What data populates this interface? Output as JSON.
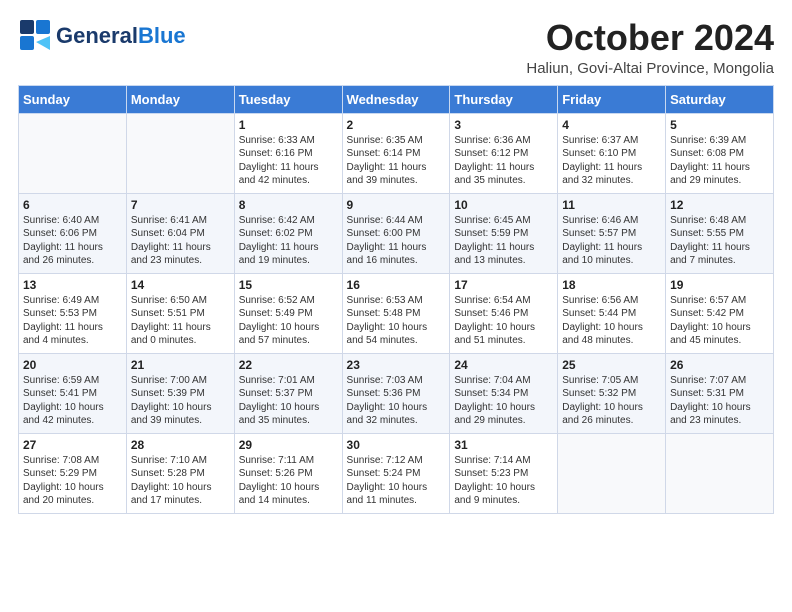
{
  "header": {
    "logo_general": "General",
    "logo_blue": "Blue",
    "month_title": "October 2024",
    "location": "Haliun, Govi-Altai Province, Mongolia"
  },
  "days_of_week": [
    "Sunday",
    "Monday",
    "Tuesday",
    "Wednesday",
    "Thursday",
    "Friday",
    "Saturday"
  ],
  "weeks": [
    [
      {
        "day": "",
        "info": ""
      },
      {
        "day": "",
        "info": ""
      },
      {
        "day": "1",
        "info": "Sunrise: 6:33 AM\nSunset: 6:16 PM\nDaylight: 11 hours and 42 minutes."
      },
      {
        "day": "2",
        "info": "Sunrise: 6:35 AM\nSunset: 6:14 PM\nDaylight: 11 hours and 39 minutes."
      },
      {
        "day": "3",
        "info": "Sunrise: 6:36 AM\nSunset: 6:12 PM\nDaylight: 11 hours and 35 minutes."
      },
      {
        "day": "4",
        "info": "Sunrise: 6:37 AM\nSunset: 6:10 PM\nDaylight: 11 hours and 32 minutes."
      },
      {
        "day": "5",
        "info": "Sunrise: 6:39 AM\nSunset: 6:08 PM\nDaylight: 11 hours and 29 minutes."
      }
    ],
    [
      {
        "day": "6",
        "info": "Sunrise: 6:40 AM\nSunset: 6:06 PM\nDaylight: 11 hours and 26 minutes."
      },
      {
        "day": "7",
        "info": "Sunrise: 6:41 AM\nSunset: 6:04 PM\nDaylight: 11 hours and 23 minutes."
      },
      {
        "day": "8",
        "info": "Sunrise: 6:42 AM\nSunset: 6:02 PM\nDaylight: 11 hours and 19 minutes."
      },
      {
        "day": "9",
        "info": "Sunrise: 6:44 AM\nSunset: 6:00 PM\nDaylight: 11 hours and 16 minutes."
      },
      {
        "day": "10",
        "info": "Sunrise: 6:45 AM\nSunset: 5:59 PM\nDaylight: 11 hours and 13 minutes."
      },
      {
        "day": "11",
        "info": "Sunrise: 6:46 AM\nSunset: 5:57 PM\nDaylight: 11 hours and 10 minutes."
      },
      {
        "day": "12",
        "info": "Sunrise: 6:48 AM\nSunset: 5:55 PM\nDaylight: 11 hours and 7 minutes."
      }
    ],
    [
      {
        "day": "13",
        "info": "Sunrise: 6:49 AM\nSunset: 5:53 PM\nDaylight: 11 hours and 4 minutes."
      },
      {
        "day": "14",
        "info": "Sunrise: 6:50 AM\nSunset: 5:51 PM\nDaylight: 11 hours and 0 minutes."
      },
      {
        "day": "15",
        "info": "Sunrise: 6:52 AM\nSunset: 5:49 PM\nDaylight: 10 hours and 57 minutes."
      },
      {
        "day": "16",
        "info": "Sunrise: 6:53 AM\nSunset: 5:48 PM\nDaylight: 10 hours and 54 minutes."
      },
      {
        "day": "17",
        "info": "Sunrise: 6:54 AM\nSunset: 5:46 PM\nDaylight: 10 hours and 51 minutes."
      },
      {
        "day": "18",
        "info": "Sunrise: 6:56 AM\nSunset: 5:44 PM\nDaylight: 10 hours and 48 minutes."
      },
      {
        "day": "19",
        "info": "Sunrise: 6:57 AM\nSunset: 5:42 PM\nDaylight: 10 hours and 45 minutes."
      }
    ],
    [
      {
        "day": "20",
        "info": "Sunrise: 6:59 AM\nSunset: 5:41 PM\nDaylight: 10 hours and 42 minutes."
      },
      {
        "day": "21",
        "info": "Sunrise: 7:00 AM\nSunset: 5:39 PM\nDaylight: 10 hours and 39 minutes."
      },
      {
        "day": "22",
        "info": "Sunrise: 7:01 AM\nSunset: 5:37 PM\nDaylight: 10 hours and 35 minutes."
      },
      {
        "day": "23",
        "info": "Sunrise: 7:03 AM\nSunset: 5:36 PM\nDaylight: 10 hours and 32 minutes."
      },
      {
        "day": "24",
        "info": "Sunrise: 7:04 AM\nSunset: 5:34 PM\nDaylight: 10 hours and 29 minutes."
      },
      {
        "day": "25",
        "info": "Sunrise: 7:05 AM\nSunset: 5:32 PM\nDaylight: 10 hours and 26 minutes."
      },
      {
        "day": "26",
        "info": "Sunrise: 7:07 AM\nSunset: 5:31 PM\nDaylight: 10 hours and 23 minutes."
      }
    ],
    [
      {
        "day": "27",
        "info": "Sunrise: 7:08 AM\nSunset: 5:29 PM\nDaylight: 10 hours and 20 minutes."
      },
      {
        "day": "28",
        "info": "Sunrise: 7:10 AM\nSunset: 5:28 PM\nDaylight: 10 hours and 17 minutes."
      },
      {
        "day": "29",
        "info": "Sunrise: 7:11 AM\nSunset: 5:26 PM\nDaylight: 10 hours and 14 minutes."
      },
      {
        "day": "30",
        "info": "Sunrise: 7:12 AM\nSunset: 5:24 PM\nDaylight: 10 hours and 11 minutes."
      },
      {
        "day": "31",
        "info": "Sunrise: 7:14 AM\nSunset: 5:23 PM\nDaylight: 10 hours and 9 minutes."
      },
      {
        "day": "",
        "info": ""
      },
      {
        "day": "",
        "info": ""
      }
    ]
  ]
}
